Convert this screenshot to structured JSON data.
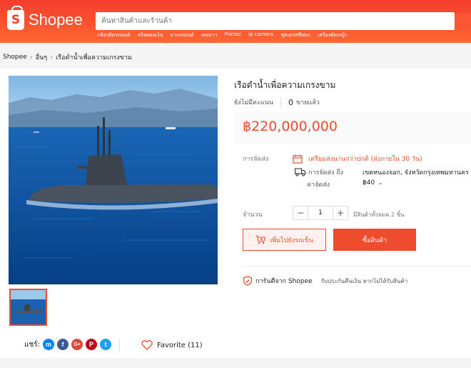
{
  "header": {
    "logo_text": "Shopee",
    "logo_letter": "S",
    "search_placeholder": "ค้นหาสินค้าและร้านค้า",
    "hotwords": [
      "กล้องติดรถยนต์",
      "สร้อยคอเงิน",
      "ยางรถยนต์",
      "เคสยาว",
      "Printer",
      "ip camera",
      "ชุดเดรสชีฟอง",
      "เครื่องตัดหญ้า"
    ]
  },
  "breadcrumb": [
    "Shopee",
    "อื่นๆ",
    "เรือดำน้ำเพื่อความเกรงขาม"
  ],
  "product": {
    "title": "เรือดำน้ำเพื่อความเกรงขาม",
    "rating_text": "ยังไม่มีคะแนน",
    "sold_count": "0",
    "sold_label": "ขายแล้ว",
    "price": "฿220,000,000",
    "shipping_label": "การจัดส่ง",
    "preorder_text": "เตรียมส่งนานกว่าปกติ (ส่งภายใน 30 วัน)",
    "ship_to_label": "การจัดส่ง ถึง",
    "ship_to_value": "เขตหนองจอก, จังหวัดกรุงเทพมหานคร",
    "ship_cost_label": "ค่าจัดส่ง",
    "ship_cost_value": "฿40",
    "qty_label": "จำนวน",
    "qty_value": "1",
    "qty_minus": "−",
    "qty_plus": "+",
    "stock_text": "มีสินค้าทั้งหมด 2 ชิ้น",
    "add_to_cart": "เพิ่มไปยังรถเข็น",
    "buy_now": "ซื้อสินค้า",
    "guarantee_title": "การันตีจาก Shopee",
    "guarantee_text": "รับประกันคืนเงิน หากไม่ได้รับสินค้า"
  },
  "share": {
    "label": "แชร์:",
    "icons": [
      {
        "name": "messenger",
        "glyph": "m",
        "color": "#0084ff"
      },
      {
        "name": "facebook",
        "glyph": "f",
        "color": "#3b5999"
      },
      {
        "name": "google-plus",
        "glyph": "G+",
        "color": "#dd4b39"
      },
      {
        "name": "pinterest",
        "glyph": "P",
        "color": "#bd081c"
      },
      {
        "name": "twitter",
        "glyph": "t",
        "color": "#1da1f2"
      }
    ]
  },
  "favorite": {
    "label": "Favorite (11)"
  },
  "colors": {
    "brand": "#ee4d2d",
    "sea": "#0a5aa8",
    "sky": "#8ec3ea"
  }
}
